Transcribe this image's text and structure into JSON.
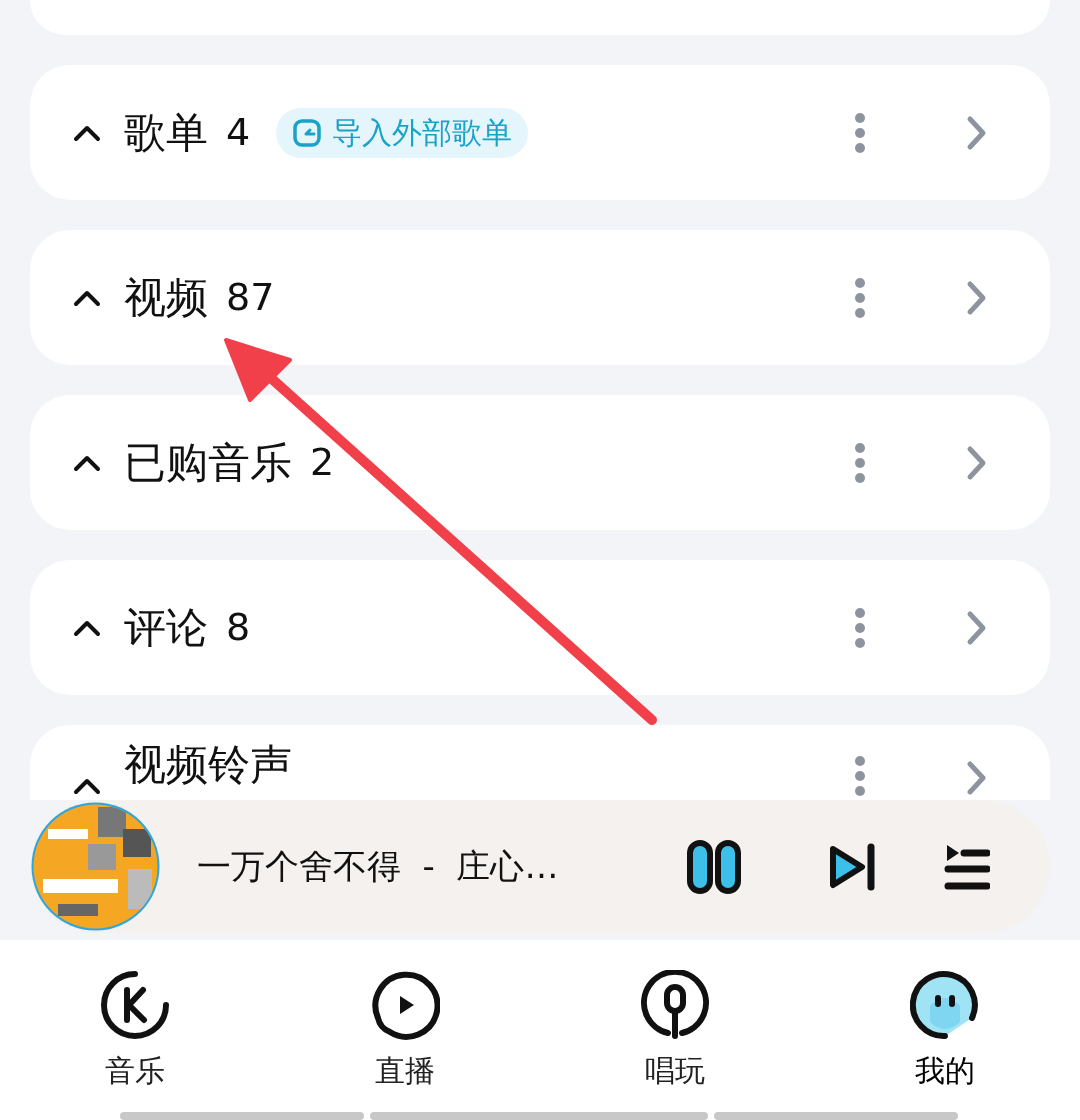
{
  "sections": [
    {
      "title": "歌单",
      "count": "4",
      "expanded": true,
      "badge": "导入外部歌单"
    },
    {
      "title": "视频",
      "count": "87",
      "expanded": true
    },
    {
      "title": "已购音乐",
      "count": "2",
      "expanded": true
    },
    {
      "title": "评论",
      "count": "8",
      "expanded": true
    },
    {
      "title": "视频铃声",
      "expanded": true
    }
  ],
  "now_playing": {
    "title": "一万个舍不得  -  庄心…",
    "playing": true
  },
  "nav": [
    {
      "kind": "music",
      "label": "音乐",
      "selected": false
    },
    {
      "kind": "live",
      "label": "直播",
      "selected": false
    },
    {
      "kind": "sing",
      "label": "唱玩",
      "selected": false
    },
    {
      "kind": "me",
      "label": "我的",
      "selected": true
    }
  ]
}
